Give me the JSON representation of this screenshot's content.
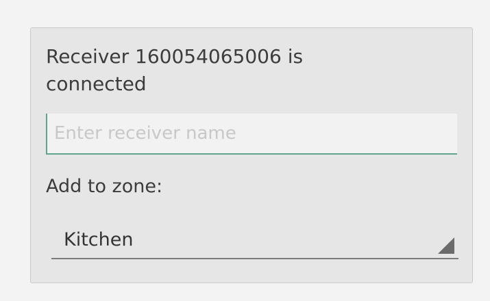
{
  "dialog": {
    "message": "Receiver 160054065006 is connected",
    "name_input": {
      "value": "",
      "placeholder": "Enter receiver name"
    },
    "zone_label": "Add to zone:",
    "zone_select": {
      "selected": "Kitchen"
    }
  },
  "colors": {
    "accent": "#5fa58d",
    "dialog_background": "#e6e6e6",
    "text": "#3c3c3c"
  }
}
